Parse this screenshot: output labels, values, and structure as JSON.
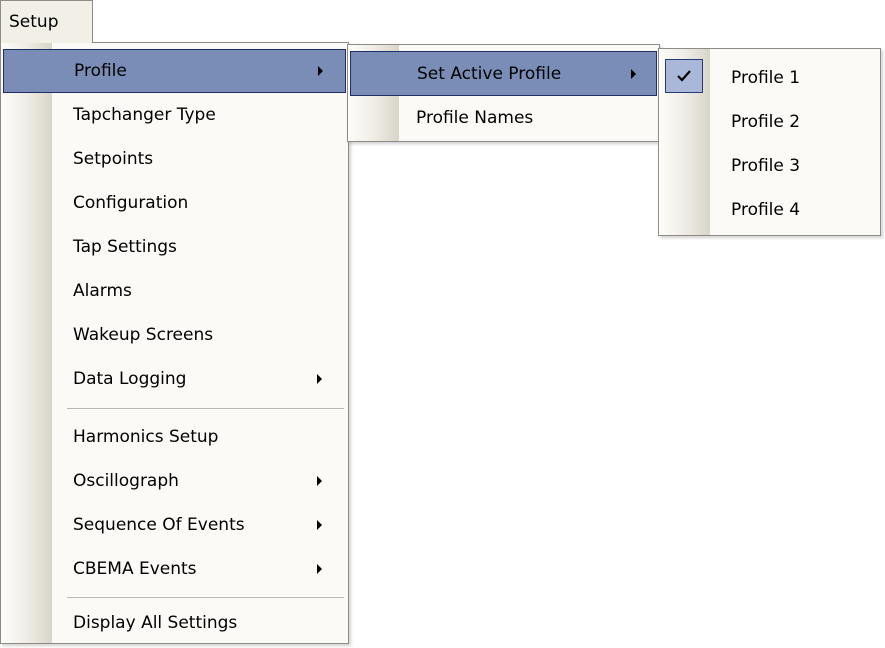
{
  "menubar": {
    "setup_label": "Setup"
  },
  "setup_menu": {
    "items": [
      {
        "label": "Profile"
      },
      {
        "label": "Tapchanger Type"
      },
      {
        "label": "Setpoints"
      },
      {
        "label": "Configuration"
      },
      {
        "label": "Tap Settings"
      },
      {
        "label": "Alarms"
      },
      {
        "label": "Wakeup Screens"
      },
      {
        "label": "Data Logging"
      },
      {
        "label": "Harmonics Setup"
      },
      {
        "label": "Oscillograph"
      },
      {
        "label": "Sequence Of Events"
      },
      {
        "label": "CBEMA Events"
      },
      {
        "label": "Display All Settings"
      }
    ]
  },
  "profile_menu": {
    "items": [
      {
        "label": "Set Active Profile"
      },
      {
        "label": "Profile Names"
      }
    ]
  },
  "active_profile_menu": {
    "items": [
      {
        "label": "Profile 1",
        "checked": true
      },
      {
        "label": "Profile 2",
        "checked": false
      },
      {
        "label": "Profile 3",
        "checked": false
      },
      {
        "label": "Profile 4",
        "checked": false
      }
    ]
  },
  "colors": {
    "highlight": "#7a8db7",
    "highlight_border": "#1f2f63",
    "menu_background": "#fbfaf7",
    "menu_border": "#8d8b85"
  },
  "icons": {
    "submenu_arrow": "chevron-right-icon",
    "check": "checkmark-icon"
  }
}
